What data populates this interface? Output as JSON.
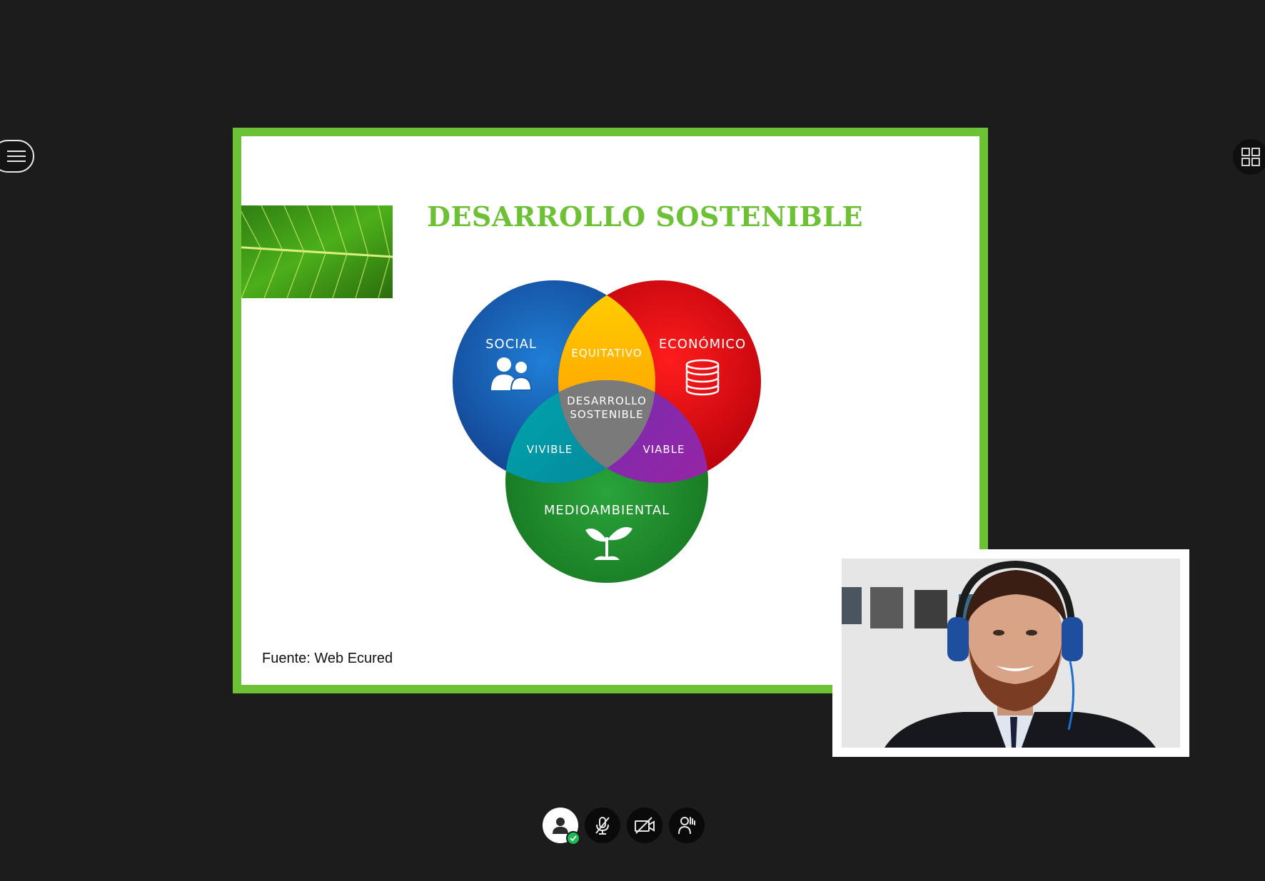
{
  "slide": {
    "title": "DESARROLLO SOSTENIBLE",
    "source": "Fuente: Web Ecured",
    "venn": {
      "social": "SOCIAL",
      "economico": "ECONÓMICO",
      "medioambiental": "MEDIOAMBIENTAL",
      "equitativo": "EQUITATIVO",
      "vivible": "VIVIBLE",
      "viable": "VIABLE",
      "center_line1": "DESARROLLO",
      "center_line2": "SOSTENIBLE"
    }
  },
  "controls": {
    "icons": [
      "user-icon",
      "microphone-muted-icon",
      "camera-off-icon",
      "raise-hand-icon"
    ],
    "user_status": "connected"
  },
  "colors": {
    "accent_green": "#6cc135",
    "social_blue": "#1a5fb4",
    "economic_red": "#d9000f",
    "environment_green": "#1e8a2e",
    "equitable_orange": "#ffb000",
    "center_gray": "#7a7a7a",
    "status_green": "#1db954"
  }
}
